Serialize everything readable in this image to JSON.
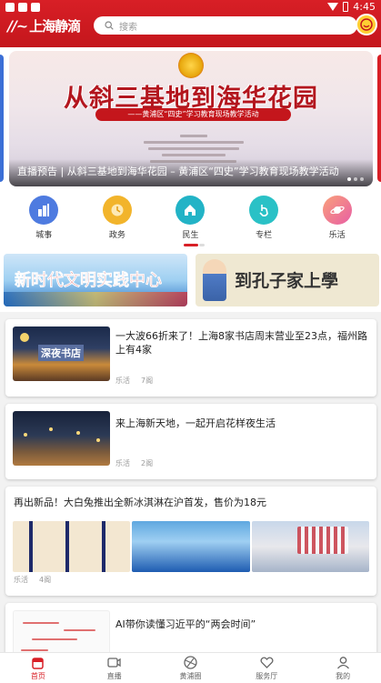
{
  "status_bar": {
    "time": "4:45"
  },
  "header": {
    "logo_text": "上海静滴",
    "search_placeholder": "搜索"
  },
  "banner": {
    "title": "从斜三基地到海华花园",
    "ribbon": "——黄浦区“四史”学习教育现场教学活动",
    "caption": "直播预告 | 从斜三基地到海华花园 – 黄浦区“四史”学习教育现场教学活动"
  },
  "categories": [
    {
      "label": "城事",
      "icon": "building-icon",
      "color": "#4e7be0"
    },
    {
      "label": "政务",
      "icon": "clock-icon",
      "color": "#f2b42b"
    },
    {
      "label": "民生",
      "icon": "home-icon",
      "color": "#22b3c6"
    },
    {
      "label": "专栏",
      "icon": "hand-icon",
      "color": "#2ac1c6"
    },
    {
      "label": "乐活",
      "icon": "planet-icon",
      "color": "#f57ca0"
    }
  ],
  "promos": [
    {
      "text": "新时代文明实践中心"
    },
    {
      "text": "到孔子家上學"
    }
  ],
  "articles": [
    {
      "title": "一大波66折来了！上海8家书店周末营业至23点，福州路上有4家",
      "category": "乐活",
      "time": "7阁",
      "thumb_text": "深夜书店"
    },
    {
      "title": "来上海新天地，一起开启花样夜生活",
      "category": "乐活",
      "time": "2阁"
    },
    {
      "title": "再出新品！大白兔推出全新冰淇淋在沪首发，售价为18元",
      "category": "乐活",
      "time": "4阁"
    },
    {
      "title": "AI带你读懂习近平的“两会时间”"
    }
  ],
  "tabbar": [
    {
      "label": "首页",
      "icon": "home-tab-icon",
      "active": true
    },
    {
      "label": "直播",
      "icon": "video-icon",
      "active": false
    },
    {
      "label": "黄浦圈",
      "icon": "globe-icon",
      "active": false
    },
    {
      "label": "服务厅",
      "icon": "heart-hand-icon",
      "active": false
    },
    {
      "label": "我的",
      "icon": "user-icon",
      "active": false
    }
  ],
  "colors": {
    "brand_red": "#d81f26",
    "accent_yellow": "#ffcf33"
  }
}
